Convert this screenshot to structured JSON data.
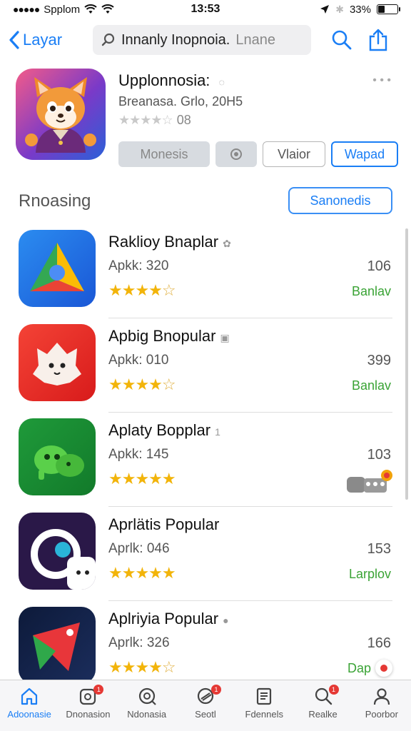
{
  "status": {
    "carrier": "Spplom",
    "time": "13:53",
    "battery": "33%",
    "battery_level": 0.33
  },
  "nav": {
    "back_label": "Layar",
    "search_query": "Innanly Inopnoia.",
    "search_rest": "Lnane",
    "icons": [
      "search-icon",
      "share-icon"
    ]
  },
  "app": {
    "title": "Upplonnosia:",
    "subtitle": "Breanasa. Grlo, 20H5",
    "rating_stars": "★★★★☆",
    "rating_count": "08",
    "buttons": {
      "grey": "Monesis",
      "outline": "Vlaior",
      "blue": "Wapad"
    }
  },
  "section": {
    "title": "Rnoasing",
    "button": "Sanonedis"
  },
  "apps": [
    {
      "title": "Raklioy Bnaplar",
      "meta": "Apkk: 320",
      "stars_on": "★★★★",
      "stars_off": "☆",
      "count": "106",
      "action": "Banlav"
    },
    {
      "title": "Apbig Bnopular",
      "meta": "Apkk: 010",
      "stars_on": "★★★★",
      "stars_off": "☆",
      "count": "399",
      "action": "Banlav"
    },
    {
      "title": "Aplaty Bopplar",
      "meta": "Apkk: 145",
      "stars_on": "★★★★★",
      "stars_off": "",
      "count": "103",
      "action": ""
    },
    {
      "title": "Aprlätis Popular",
      "meta": "Aprlk: 046",
      "stars_on": "★★★★★",
      "stars_off": "",
      "count": "153",
      "action": "Larplov"
    },
    {
      "title": "Aplriyia Popular",
      "meta": "Aprlk: 326",
      "stars_on": "★★★★",
      "stars_off": "☆",
      "count": "166",
      "action": "Dap"
    }
  ],
  "tabs": [
    {
      "label": "Adoonasie",
      "icon": "home-icon",
      "badge": ""
    },
    {
      "label": "Dnonasion",
      "icon": "apps-icon",
      "badge": "1"
    },
    {
      "label": "Ndonasia",
      "icon": "discover-icon",
      "badge": ""
    },
    {
      "label": "Seotl",
      "icon": "games-icon",
      "badge": "1"
    },
    {
      "label": "Fdennels",
      "icon": "list-icon",
      "badge": ""
    },
    {
      "label": "Realke",
      "icon": "search-icon",
      "badge": "1"
    },
    {
      "label": "Poorbor",
      "icon": "profile-icon",
      "badge": ""
    }
  ]
}
